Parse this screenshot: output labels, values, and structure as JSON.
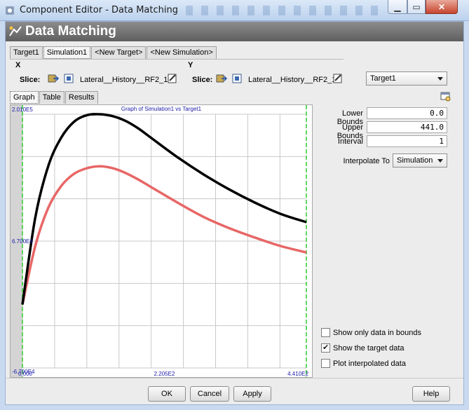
{
  "window": {
    "title": "Component Editor - Data Matching"
  },
  "header": {
    "title": "Data Matching"
  },
  "top_tabs": [
    {
      "label": "Target1",
      "active": false
    },
    {
      "label": "Simulation1",
      "active": true
    },
    {
      "label": "<New Target>",
      "active": false
    },
    {
      "label": "<New Simulation>",
      "active": false
    }
  ],
  "slice_x": {
    "axis": "X",
    "label": "Slice:",
    "value": "Lateral__History__RF2_1"
  },
  "slice_y": {
    "axis": "Y",
    "label": "Slice:",
    "value": "Lateral__History__RF2_1"
  },
  "target_select": {
    "value": "Target1"
  },
  "sub_tabs": [
    {
      "label": "Graph",
      "active": true
    },
    {
      "label": "Table",
      "active": false
    },
    {
      "label": "Results",
      "active": false
    }
  ],
  "graph": {
    "title": "Graph of Simulation1 vs Target1",
    "y_top": "2.010E5",
    "y_mid": "6.700E4",
    "y_bottom": "-6.700E4",
    "x_left": "0.000",
    "x_mid": "2.205E2",
    "x_right": "4.410E2"
  },
  "chart_data": {
    "type": "line",
    "title": "Graph of Simulation1 vs Target1",
    "xlim": [
      0,
      441
    ],
    "ylim": [
      -67000,
      201000
    ],
    "grid": true,
    "series": [
      {
        "color": "#000000",
        "x": [
          0,
          20,
          40,
          60,
          80,
          100,
          120,
          140,
          160,
          180,
          200,
          240,
          280,
          320,
          360,
          400,
          441
        ],
        "y": [
          0,
          92000,
          146000,
          176000,
          193000,
          200000,
          201000,
          199000,
          194000,
          186000,
          176000,
          156000,
          138000,
          122000,
          108000,
          96000,
          87000
        ]
      },
      {
        "color": "#e86666",
        "x": [
          0,
          20,
          40,
          60,
          80,
          100,
          120,
          140,
          160,
          180,
          200,
          240,
          280,
          320,
          360,
          400,
          441
        ],
        "y": [
          0,
          62000,
          102000,
          125000,
          138000,
          144000,
          146000,
          144000,
          139000,
          132000,
          124000,
          108000,
          93000,
          81000,
          71000,
          62000,
          55000
        ]
      }
    ]
  },
  "form": {
    "lower_bounds": {
      "label": "Lower Bounds",
      "value": "0.0"
    },
    "upper_bounds": {
      "label": "Upper Bounds",
      "value": "441.0"
    },
    "interval": {
      "label": "Interval",
      "value": "1"
    },
    "interpolate": {
      "label": "Interpolate To",
      "value": "Simulation"
    }
  },
  "checks": [
    {
      "label": "Show only data in bounds",
      "checked": false
    },
    {
      "label": "Show the target data",
      "checked": true
    },
    {
      "label": "Plot interpolated data",
      "checked": false
    }
  ],
  "buttons": {
    "ok": "OK",
    "cancel": "Cancel",
    "apply": "Apply",
    "help": "Help"
  }
}
